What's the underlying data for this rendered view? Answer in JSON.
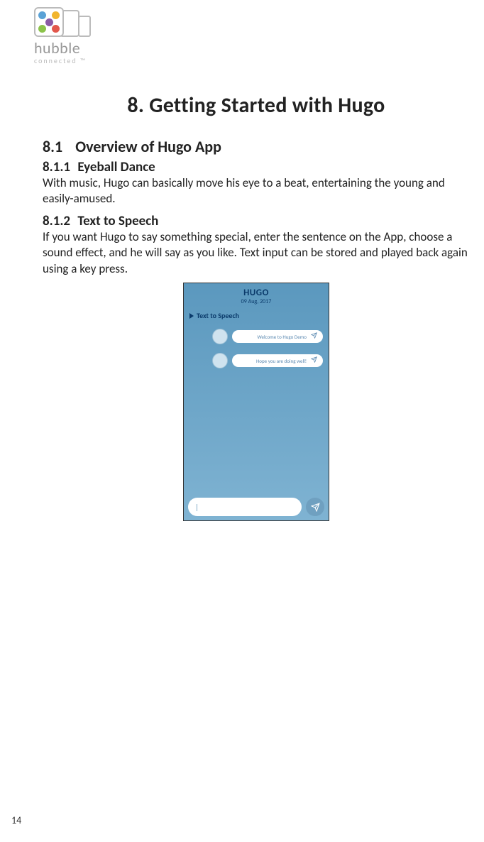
{
  "logo": {
    "brand": "hubble",
    "sub": "connected ™"
  },
  "heading": "8. Getting Started with Hugo",
  "section": {
    "num": "8.1",
    "title": "Overview of Hugo App"
  },
  "sub1": {
    "num": "8.1.1",
    "title": "Eyeball Dance",
    "body": "With music, Hugo can basically move his eye to a beat, entertaining the young and easily-amused."
  },
  "sub2": {
    "num": "8.1.2",
    "title": "Text to Speech",
    "body": "If you want Hugo to say something special, enter the sentence on the App, choose a sound effect, and he will say as you like. Text input can be stored and played back again using a key press."
  },
  "phone": {
    "title": "HUGO",
    "date": "09 Aug, 2017",
    "tab": "Text to Speech",
    "bubbles": [
      "Welcome to Hugo Demo",
      "Hope you are doing well!"
    ],
    "cursor": "|"
  },
  "page_number": "14"
}
